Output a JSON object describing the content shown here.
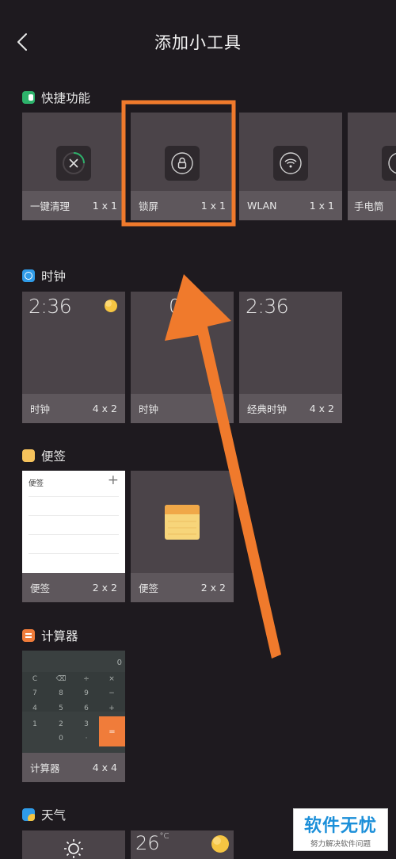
{
  "header": {
    "title": "添加小工具"
  },
  "sections": {
    "quick": {
      "label": "快捷功能",
      "cards": [
        {
          "name": "一键清理",
          "size": "1 x 1"
        },
        {
          "name": "锁屏",
          "size": "1 x 1"
        },
        {
          "name": "WLAN",
          "size": "1 x 1"
        },
        {
          "name": "手电筒",
          "size": ""
        }
      ]
    },
    "clock": {
      "label": "时钟",
      "cards": [
        {
          "name": "时钟",
          "size": "4 x 2",
          "time": "2:36"
        },
        {
          "name": "时钟",
          "size": "4",
          "time": "0"
        },
        {
          "name": "经典时钟",
          "size": "4 x 2",
          "time": "2:36"
        }
      ]
    },
    "notes": {
      "label": "便签",
      "cards": [
        {
          "name": "便签",
          "size": "2 x 2",
          "preview_title": "便签",
          "preview_plus": "+"
        },
        {
          "name": "便签",
          "size": "2 x 2"
        }
      ]
    },
    "calculator": {
      "label": "计算器",
      "cards": [
        {
          "name": "计算器",
          "size": "4 x 4",
          "display": "0",
          "keys": [
            "C",
            "⌫",
            "÷",
            "×",
            "7",
            "8",
            "9",
            "−",
            "4",
            "5",
            "6",
            "+",
            "1",
            "2",
            "3",
            "0",
            "·",
            "="
          ]
        }
      ]
    },
    "weather": {
      "label": "天气",
      "cards": [
        {
          "name": "",
          "temp": ""
        },
        {
          "name": "",
          "temp": "26",
          "unit": "°C"
        }
      ]
    }
  },
  "watermark": {
    "main": "软件无忧",
    "sub": "努力解决软件问题"
  },
  "colors": {
    "background": "#1e1a1f",
    "card": "#4b4449",
    "card_footer": "#5e575c",
    "highlight_orange": "#f07a2c",
    "quick_icon": "#2db26b",
    "clock_icon": "#2f9be8",
    "notes_icon": "#f5c25c",
    "calc_icon": "#f07c3a"
  }
}
